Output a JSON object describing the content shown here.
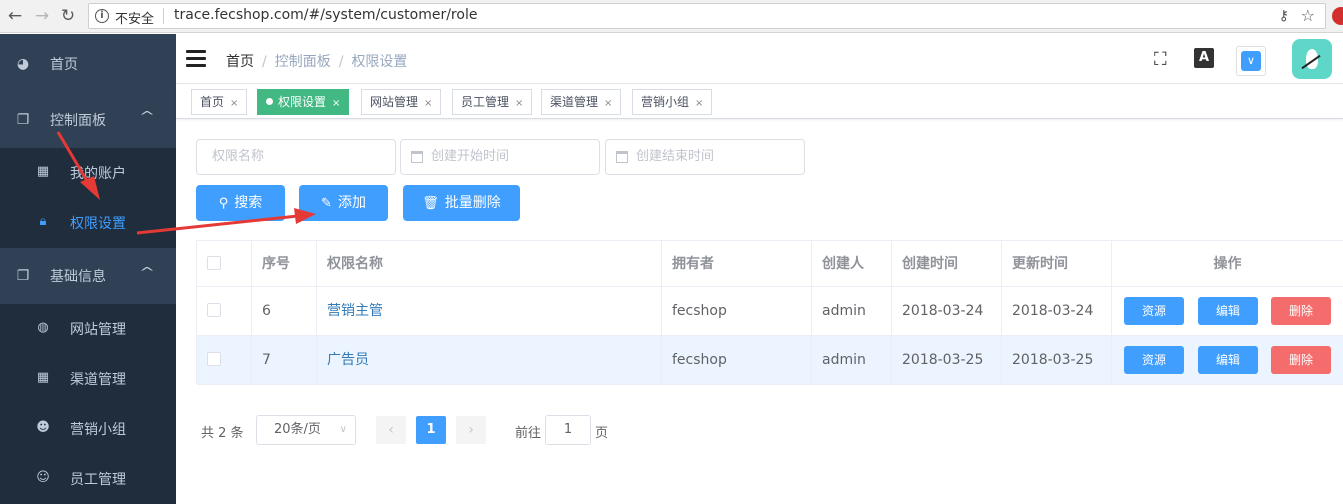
{
  "browser": {
    "security_label": "不安全",
    "url": "trace.fecshop.com/#/system/customer/role"
  },
  "sidebar": {
    "items": [
      {
        "label": "首页",
        "icon": "dashboard-icon"
      },
      {
        "label": "控制面板",
        "icon": "copy-icon",
        "expanded": true
      },
      {
        "label": "我的账户",
        "icon": "table-icon"
      },
      {
        "label": "权限设置",
        "icon": "lock-icon",
        "active": true
      },
      {
        "label": "基础信息",
        "icon": "copy-icon",
        "expanded": true
      },
      {
        "label": "网站管理",
        "icon": "globe-icon"
      },
      {
        "label": "渠道管理",
        "icon": "table-icon"
      },
      {
        "label": "营销小组",
        "icon": "users-icon"
      },
      {
        "label": "员工管理",
        "icon": "user-icon"
      }
    ]
  },
  "breadcrumb": [
    "首页",
    "控制面板",
    "权限设置"
  ],
  "tags": [
    {
      "label": "首页",
      "active": false
    },
    {
      "label": "权限设置",
      "active": true
    },
    {
      "label": "网站管理",
      "active": false
    },
    {
      "label": "员工管理",
      "active": false
    },
    {
      "label": "渠道管理",
      "active": false
    },
    {
      "label": "营销小组",
      "active": false
    }
  ],
  "tag_close": "×",
  "filters": {
    "role_name_placeholder": "权限名称",
    "start_time_placeholder": "创建开始时间",
    "end_time_placeholder": "创建结束时间"
  },
  "buttons": {
    "search": "搜索",
    "add": "添加",
    "batch_delete": "批量删除"
  },
  "table": {
    "columns": [
      "序号",
      "权限名称",
      "拥有者",
      "创建人",
      "创建时间",
      "更新时间",
      "操作"
    ],
    "rows": [
      {
        "id": "6",
        "name": "营销主管",
        "owner": "fecshop",
        "creator": "admin",
        "created": "2018-03-24",
        "updated": "2018-03-24"
      },
      {
        "id": "7",
        "name": "广告员",
        "owner": "fecshop",
        "creator": "admin",
        "created": "2018-03-25",
        "updated": "2018-03-25"
      }
    ],
    "actions": {
      "resource": "资源",
      "edit": "编辑",
      "delete": "删除"
    }
  },
  "pagination": {
    "total": "共 2 条",
    "page_size": "20条/页",
    "current_page": "1",
    "goto_label": "前往",
    "goto_value": "1",
    "goto_suffix": "页"
  },
  "colors": {
    "sidebar_bg": "#304156",
    "primary": "#409eff",
    "active_tag": "#42b983",
    "danger": "#f56c6c",
    "annotation_arrow": "#e53935"
  }
}
